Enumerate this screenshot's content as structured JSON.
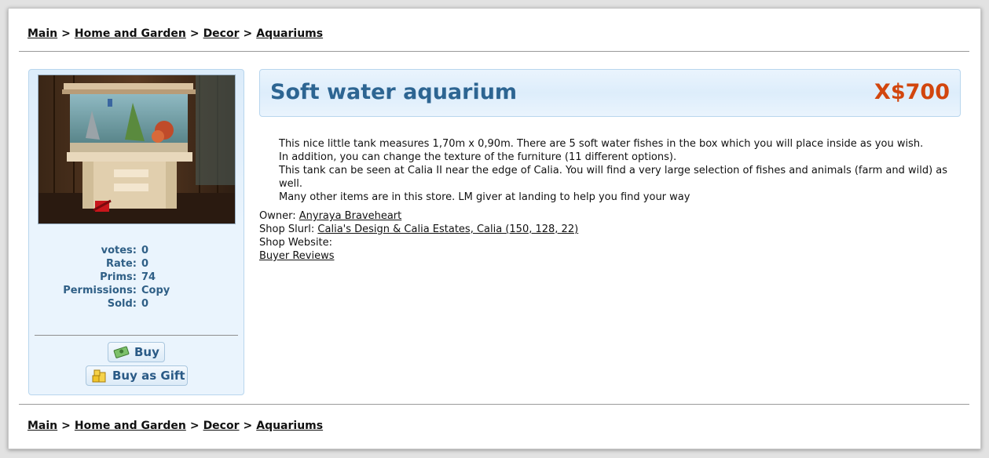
{
  "breadcrumb": [
    "Main",
    "Home and Garden",
    "Decor",
    "Aquariums"
  ],
  "breadcrumb_separator": ">",
  "product": {
    "title": "Soft water aquarium",
    "price": "X$700",
    "description": [
      "This nice little tank measures 1,70m x 0,90m. There are 5 soft water fishes in the box which you will place inside as you wish.",
      "In addition, you can change the texture of the furniture (11 different options).",
      "This tank can be seen at Calia II near the edge of Calia. You will find a very large selection of fishes and animals (farm and wild) as well.",
      "Many other items are in this store. LM giver at landing to help you find your way"
    ]
  },
  "stats": [
    {
      "label": "votes:",
      "value": "0"
    },
    {
      "label": "Rate:",
      "value": "0"
    },
    {
      "label": "Prims:",
      "value": "74"
    },
    {
      "label": "Permissions:",
      "value": "Copy"
    },
    {
      "label": "Sold:",
      "value": "0"
    }
  ],
  "buttons": {
    "buy": {
      "label": "Buy",
      "icon": "money-icon"
    },
    "gift": {
      "label": "Buy as Gift",
      "icon": "coins-icon"
    }
  },
  "info": {
    "owner_label": "Owner:",
    "owner_name": "Anyraya Braveheart",
    "slurl_label": "Shop Slurl:",
    "slurl_value": "Calia's Design & Calia Estates, Calia (150, 128, 22)",
    "website_label": "Shop Website:",
    "reviews_link": "Buyer Reviews"
  },
  "colors": {
    "title": "#2d6592",
    "price": "#d2460e",
    "panel_bg": "#eaf4fd",
    "panel_border": "#b8d6ee"
  }
}
